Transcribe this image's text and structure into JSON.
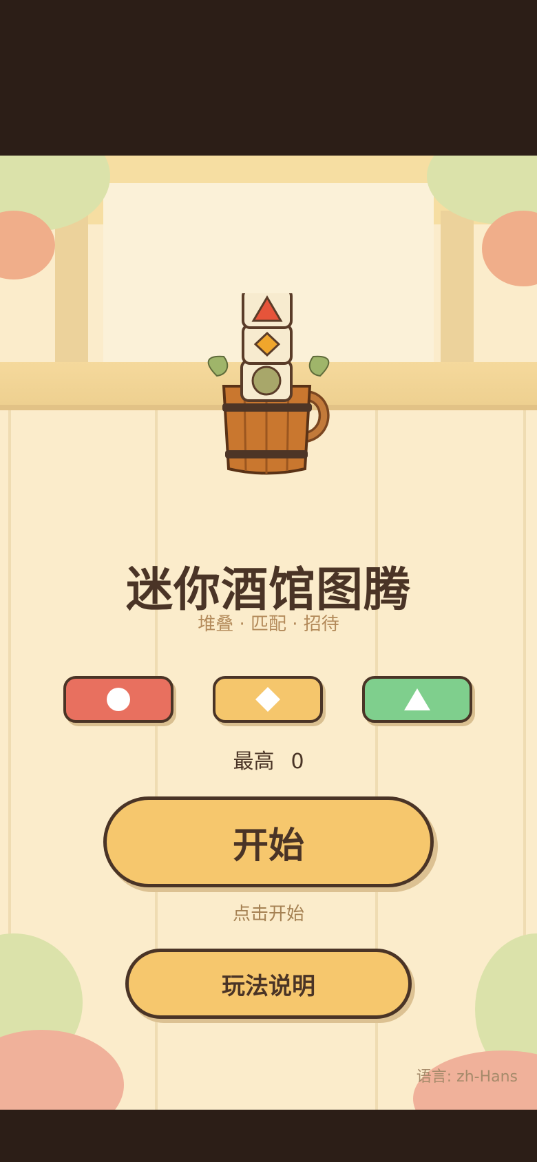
{
  "game": {
    "title": "迷你酒馆图腾",
    "subtitle": "堆叠 · 匹配 · 招待"
  },
  "shape_buttons": [
    {
      "shape": "circle",
      "color": "#e8705f"
    },
    {
      "shape": "diamond",
      "color": "#f5c66c"
    },
    {
      "shape": "triangle",
      "color": "#7fcf8d"
    }
  ],
  "best_score": {
    "label": "最高",
    "value": "0"
  },
  "start": {
    "label": "开始",
    "hint": "点击开始"
  },
  "help": {
    "label": "玩法说明"
  },
  "language": {
    "text": "语言: zh-Hans"
  },
  "colors": {
    "background": "#fbeccb",
    "button": "#f6c76d",
    "outline": "#4a3426",
    "letterbox": "#2c1e17"
  }
}
